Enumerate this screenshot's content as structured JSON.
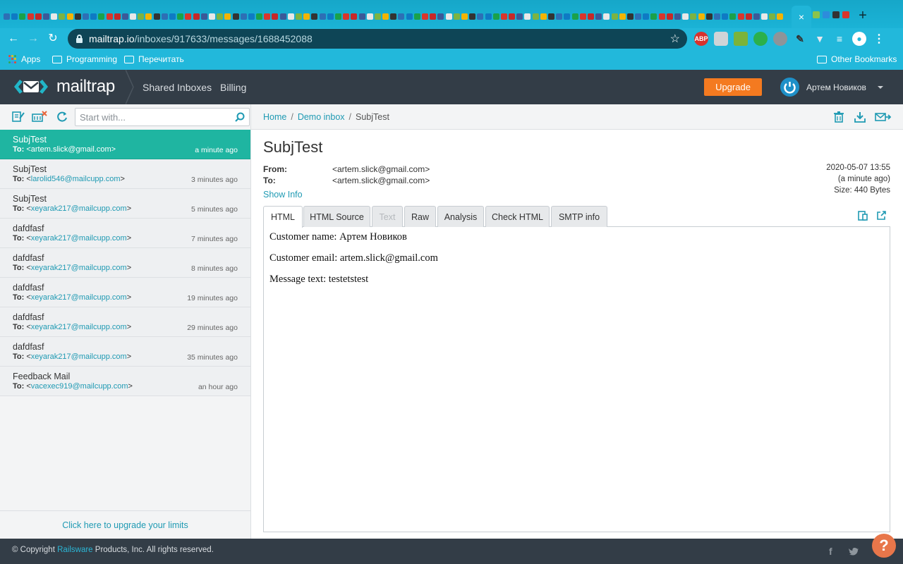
{
  "browser": {
    "url_domain": "mailtrap.io",
    "url_path": "/inboxes/917633/messages/1688452088",
    "tab_close": "×",
    "new_tab": "+",
    "bookmarks": {
      "apps": "Apps",
      "programming": "Programming",
      "reread": "Перечитать",
      "other": "Other Bookmarks"
    }
  },
  "header": {
    "logo_text": "mailtrap",
    "nav": [
      "Shared Inboxes",
      "Billing"
    ],
    "upgrade_label": "Upgrade",
    "user_name": "Артем Новиков"
  },
  "sidebar": {
    "search_placeholder": "Start with...",
    "messages": [
      {
        "subject": "SubjTest",
        "to_label": "To:",
        "to": "artem.slick@gmail.com",
        "time": "a minute ago",
        "active": true
      },
      {
        "subject": "SubjTest",
        "to_label": "To:",
        "to": "larolid546@mailcupp.com",
        "time": "3 minutes ago"
      },
      {
        "subject": "SubjTest",
        "to_label": "To:",
        "to": "xeyarak217@mailcupp.com",
        "time": "5 minutes ago"
      },
      {
        "subject": "dafdfasf",
        "to_label": "To:",
        "to": "xeyarak217@mailcupp.com",
        "time": "7 minutes ago"
      },
      {
        "subject": "dafdfasf",
        "to_label": "To:",
        "to": "xeyarak217@mailcupp.com",
        "time": "8 minutes ago"
      },
      {
        "subject": "dafdfasf",
        "to_label": "To:",
        "to": "xeyarak217@mailcupp.com",
        "time": "19 minutes ago"
      },
      {
        "subject": "dafdfasf",
        "to_label": "To:",
        "to": "xeyarak217@mailcupp.com",
        "time": "29 minutes ago"
      },
      {
        "subject": "dafdfasf",
        "to_label": "To:",
        "to": "xeyarak217@mailcupp.com",
        "time": "35 minutes ago"
      },
      {
        "subject": "Feedback Mail",
        "to_label": "To:",
        "to": "vacexec919@mailcupp.com",
        "time": "an hour ago"
      }
    ],
    "upgrade_link": "Click here to upgrade your limits"
  },
  "main": {
    "breadcrumb": {
      "home": "Home",
      "inbox": "Demo inbox",
      "current": "SubjTest",
      "sep": "/"
    },
    "title": "SubjTest",
    "from_label": "From:",
    "from": "<artem.slick@gmail.com>",
    "to_label": "To:",
    "to": "<artem.slick@gmail.com>",
    "show_info": "Show Info",
    "date": "2020-05-07 13:55",
    "relative": "(a minute ago)",
    "size": "Size: 440 Bytes",
    "tabs": [
      "HTML",
      "HTML Source",
      "Text",
      "Raw",
      "Analysis",
      "Check HTML",
      "SMTP info"
    ],
    "body_lines": [
      "Customer name: Артем Новиков",
      "Customer email: artem.slick@gmail.com",
      "Message text: testetstest"
    ]
  },
  "footer": {
    "copyright_prefix": "© Copyright ",
    "company": "Railsware",
    "copyright_suffix": " Products, Inc. All rights reserved.",
    "facebook": "f",
    "help": "?"
  },
  "colors": {
    "accent_teal": "#1fb5a1",
    "link": "#1f9ab3",
    "header_bg": "#333d47",
    "upgrade": "#f47a20",
    "browser": "#22b8db"
  }
}
